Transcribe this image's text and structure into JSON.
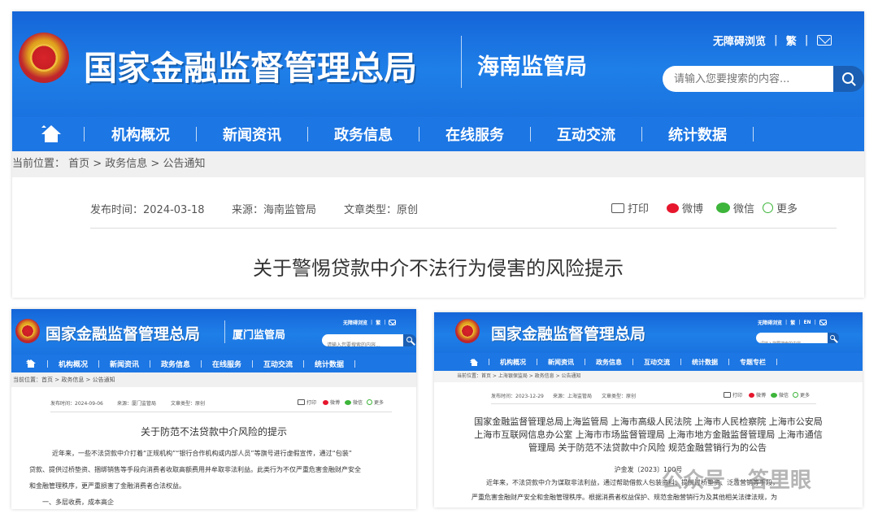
{
  "hainan": {
    "title": "国家金融监督管理总局",
    "branch": "海南监管局",
    "accessibility": "无障碍浏览",
    "traditional": "繁",
    "search_placeholder": "请输入您要搜索的内容...",
    "nav": [
      "机构概况",
      "新闻资讯",
      "政务信息",
      "在线服务",
      "互动交流",
      "统计数据"
    ],
    "breadcrumb": "当前位置： 首页 > 政务信息 > 公告通知",
    "meta": {
      "date": "发布时间：2024-03-18",
      "source": "来源：海南监管局",
      "type": "文章类型：原创"
    },
    "share": {
      "print": "打印",
      "weibo": "微博",
      "wechat": "微信",
      "more": "更多"
    },
    "doc_title": "关于警惕贷款中介不法行为侵害的风险提示"
  },
  "xiamen": {
    "title": "国家金融监督管理总局",
    "branch": "厦门监管局",
    "accessibility": "无障碍浏览",
    "traditional": "繁",
    "search_placeholder": "请输入您要搜索的内容...",
    "nav": [
      "机构概况",
      "新闻资讯",
      "政务信息",
      "在线服务",
      "互动交流",
      "统计数据"
    ],
    "breadcrumb": "当前位置：首页 > 政务信息 > 公告通知",
    "meta": {
      "date": "发布时间：2024-09-06",
      "source": "来源：厦门监管局",
      "type": "文章类型：原创"
    },
    "share": {
      "print": "打印",
      "weibo": "微博",
      "wechat": "微信",
      "more": "更多"
    },
    "doc_title": "关于防范不法贷款中介风险的提示",
    "paragraphs": [
      "近年来，一些不法贷款中介打着“正规机构”“银行合作机构或内部人员”等旗号进行虚假宣传，通过“包装”",
      "贷款、提供过桥垫资、捆绑销售等手段向消费者收取高额费用并牟取非法利益。此类行为不仅严重危害金融财产安全",
      "和金融管理秩序，更严重损害了金融消费者合法权益。",
      "一、多层收费，成本高企"
    ]
  },
  "shanghai": {
    "title": "国家金融监督管理总局",
    "accessibility": "无障碍浏览",
    "traditional": "繁",
    "english": "EN",
    "search_placeholder": "请输入您要搜索的内容",
    "nav": [
      "机构概况",
      "新闻资讯",
      "政务信息",
      "互动交流",
      "统计数据",
      "专题专栏"
    ],
    "breadcrumb": "当前位置：首页 > 上海银保监局 > 政务信息 > 公告通知",
    "meta": {
      "date": "发布时间：2023-12-29",
      "source": "来源：上海监管局",
      "type": "文章类型：原创"
    },
    "share": {
      "print": "打印",
      "weibo": "微博",
      "wechat": "微信",
      "more": "更多"
    },
    "doc_title_lines": [
      "国家金融监督管理总局上海监管局 上海市高级人民法院 上海市人民检察院 上海市公安局",
      "上海市互联网信息办公室 上海市市场监督管理局 上海市地方金融监督管理局 上海市通信",
      "管理局 关于防范不法贷款中介风险 规范金融营销行为的公告"
    ],
    "doc_number": "沪金发〔2023〕100号",
    "paragraphs": [
      "近年来，不法贷款中介为谋取非法利益，通过帮助借款人包装资料、提供过桥垫资、泛滥营销等手段，",
      "严重危害金融财产安全和金融管理秩序。根据消费者权益保护、规范金融营销行为及其他相关法律法规，为"
    ]
  },
  "watermark": "公众号 · 答里眼"
}
